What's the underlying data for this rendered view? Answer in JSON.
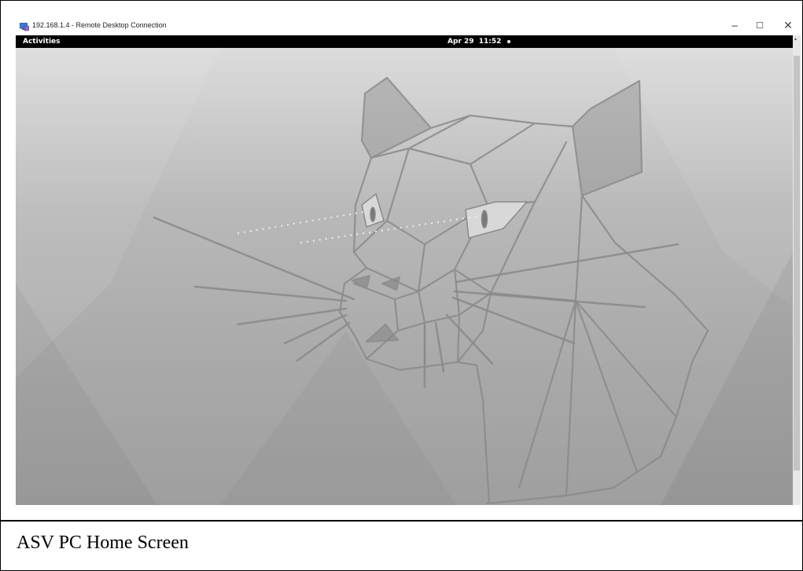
{
  "rdp_window": {
    "title": "192.168.1.4 - Remote Desktop Connection",
    "app_icon": "remote-desktop-icon",
    "controls": {
      "minimize": "−",
      "maximize": "☐",
      "close": "✕"
    }
  },
  "gnome_topbar": {
    "activities_label": "Activities",
    "clock_label": "Apr 29  11:52"
  },
  "desktop": {
    "wallpaper": "ubuntu-focal-fossa-wallpaper"
  },
  "caption": "ASV PC Home Screen",
  "colors": {
    "topbar_background": "#000000",
    "wallpaper_light": "#dcdcdc",
    "wallpaper_dark": "#9f9f9f",
    "line_art": "#8a8a8a"
  }
}
